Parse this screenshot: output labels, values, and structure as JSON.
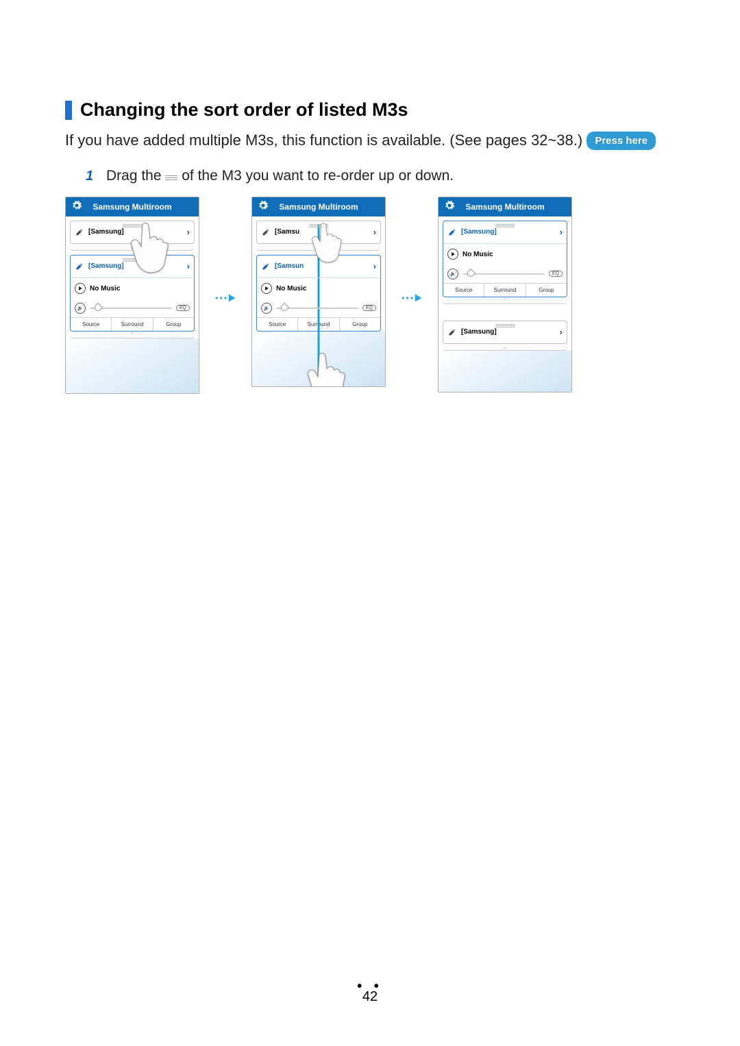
{
  "heading": "Changing the sort order of listed M3s",
  "intro_prefix": "If you have added multiple M3s, this function is available. (See pages 32~38.)",
  "press_here": "Press here",
  "steps": [
    {
      "num": "1",
      "before": "Drag the ",
      "after": " of the M3 you want to re-order up or down."
    }
  ],
  "app_title": "Samsung Multiroom",
  "device_label_a": "[Samsung]",
  "device_label_b_trunc1": "[Samsu",
  "device_label_b_trunc2": "[Samsun",
  "no_music": "No Music",
  "buttons": {
    "source": "Source",
    "surround": "Surround",
    "group": "Group"
  },
  "eq": "EQ",
  "page_number": "42"
}
